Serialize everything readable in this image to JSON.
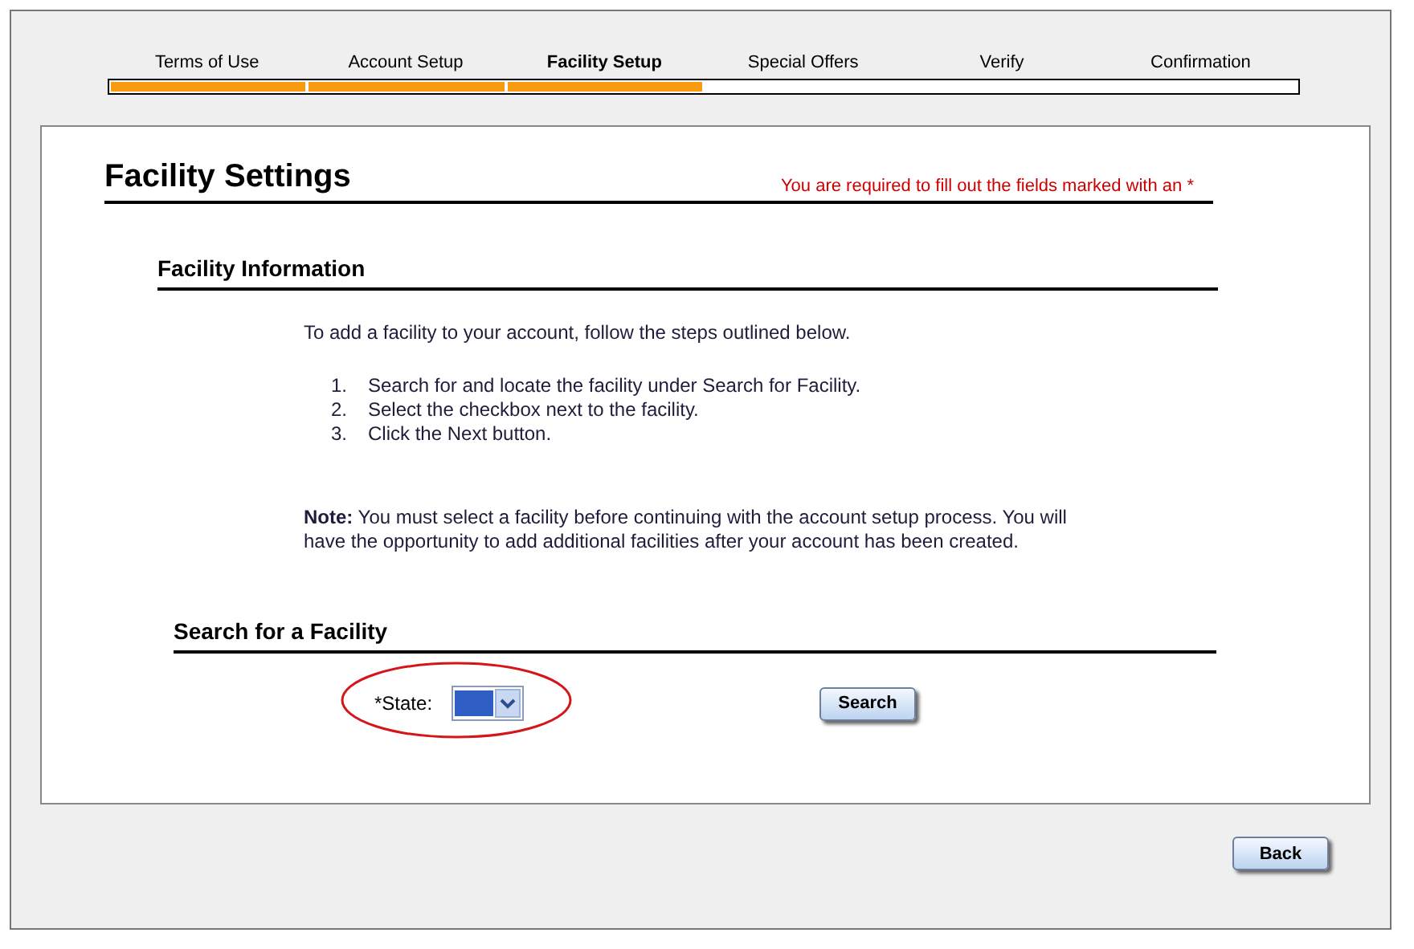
{
  "steps": [
    {
      "label": "Terms of Use",
      "selected": false,
      "completed": true
    },
    {
      "label": "Account Setup",
      "selected": false,
      "completed": true
    },
    {
      "label": "Facility Setup",
      "selected": true,
      "completed": true
    },
    {
      "label": "Special Offers",
      "selected": false,
      "completed": false
    },
    {
      "label": "Verify",
      "selected": false,
      "completed": false
    },
    {
      "label": "Confirmation",
      "selected": false,
      "completed": false
    }
  ],
  "page_title": "Facility Settings",
  "required_note": "You are required to fill out the fields marked with an *",
  "facility_information": {
    "heading": "Facility Information",
    "intro": "To add a facility to your account, follow the steps outlined below.",
    "steps": [
      {
        "number": "1.",
        "text": "Search for and locate the facility under Search for Facility."
      },
      {
        "number": "2.",
        "text": "Select the checkbox next to the facility."
      },
      {
        "number": "3.",
        "text": "Click the Next button."
      }
    ],
    "note": "**Note:**  You must select a facility before continuing with the account setup process. You will have the opportunity to add additional facilities after your account has been created."
  },
  "search": {
    "heading": "Search for a Facility",
    "state_label": "*State:",
    "state_highlighted": true,
    "button": "Search"
  },
  "back_button": "Back"
}
